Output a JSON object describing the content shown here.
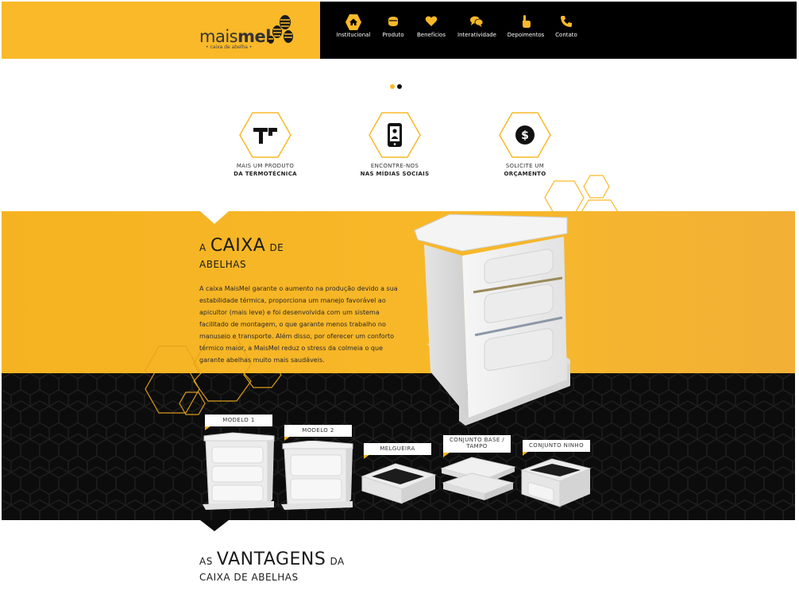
{
  "logo": {
    "brand_light": "mais",
    "brand_bold": "mel",
    "tagline": "• caixa de abelha •"
  },
  "nav": [
    {
      "label": "Institucional",
      "icon": "home-icon"
    },
    {
      "label": "Produto",
      "icon": "honey-pot-icon"
    },
    {
      "label": "Benefícios",
      "icon": "heart-icon"
    },
    {
      "label": "Interatividade",
      "icon": "chat-bubbles-icon"
    },
    {
      "label": "Depoimentos",
      "icon": "pointing-hand-icon"
    },
    {
      "label": "Contato",
      "icon": "phone-icon"
    }
  ],
  "slider": {
    "active_index": 0,
    "count": 2
  },
  "features": [
    {
      "line1": "MAIS UM PRODUTO",
      "line2": "DA TERMOTÉCNICA",
      "icon": "termotecnica-logo-icon"
    },
    {
      "line1": "ENCONTRE-NOS",
      "line2": "NAS MÍDIAS SOCIAIS",
      "icon": "smartphone-user-icon"
    },
    {
      "line1": "SOLICITE UM",
      "line2": "ORÇAMENTO",
      "icon": "dollar-coin-icon"
    }
  ],
  "caixa_section": {
    "heading_pre": "A",
    "heading_big": "CAIXA",
    "heading_post": "DE",
    "heading_line2": "ABELHAS",
    "body": "A caixa MaisMel garante o aumento na produção devido a sua estabilidade térmica, proporciona um manejo favorável ao apicultor (mais leve) e foi desenvolvida com um sistema facilitado de montagem, o que garante menos trabalho no manuseio e transporte. Além disso, por oferecer um conforto térmico maior, a MaisMel reduz o stress da colmeia o que garante abelhas muito mais saudáveis."
  },
  "models": [
    {
      "label": "MODELO 1"
    },
    {
      "label": "MODELO 2"
    },
    {
      "label": "MELGUEIRA"
    },
    {
      "label": "CONJUNTO BASE / TAMPO"
    },
    {
      "label": "CONJUNTO NINHO"
    }
  ],
  "vantagens": {
    "heading_pre": "AS",
    "heading_big": "VANTAGENS",
    "heading_post": "DA",
    "heading_line2": "CAIXA DE ABELHAS"
  },
  "colors": {
    "brand_yellow": "#f9b928",
    "black": "#000000",
    "dark_bg": "#0c0c0c"
  }
}
